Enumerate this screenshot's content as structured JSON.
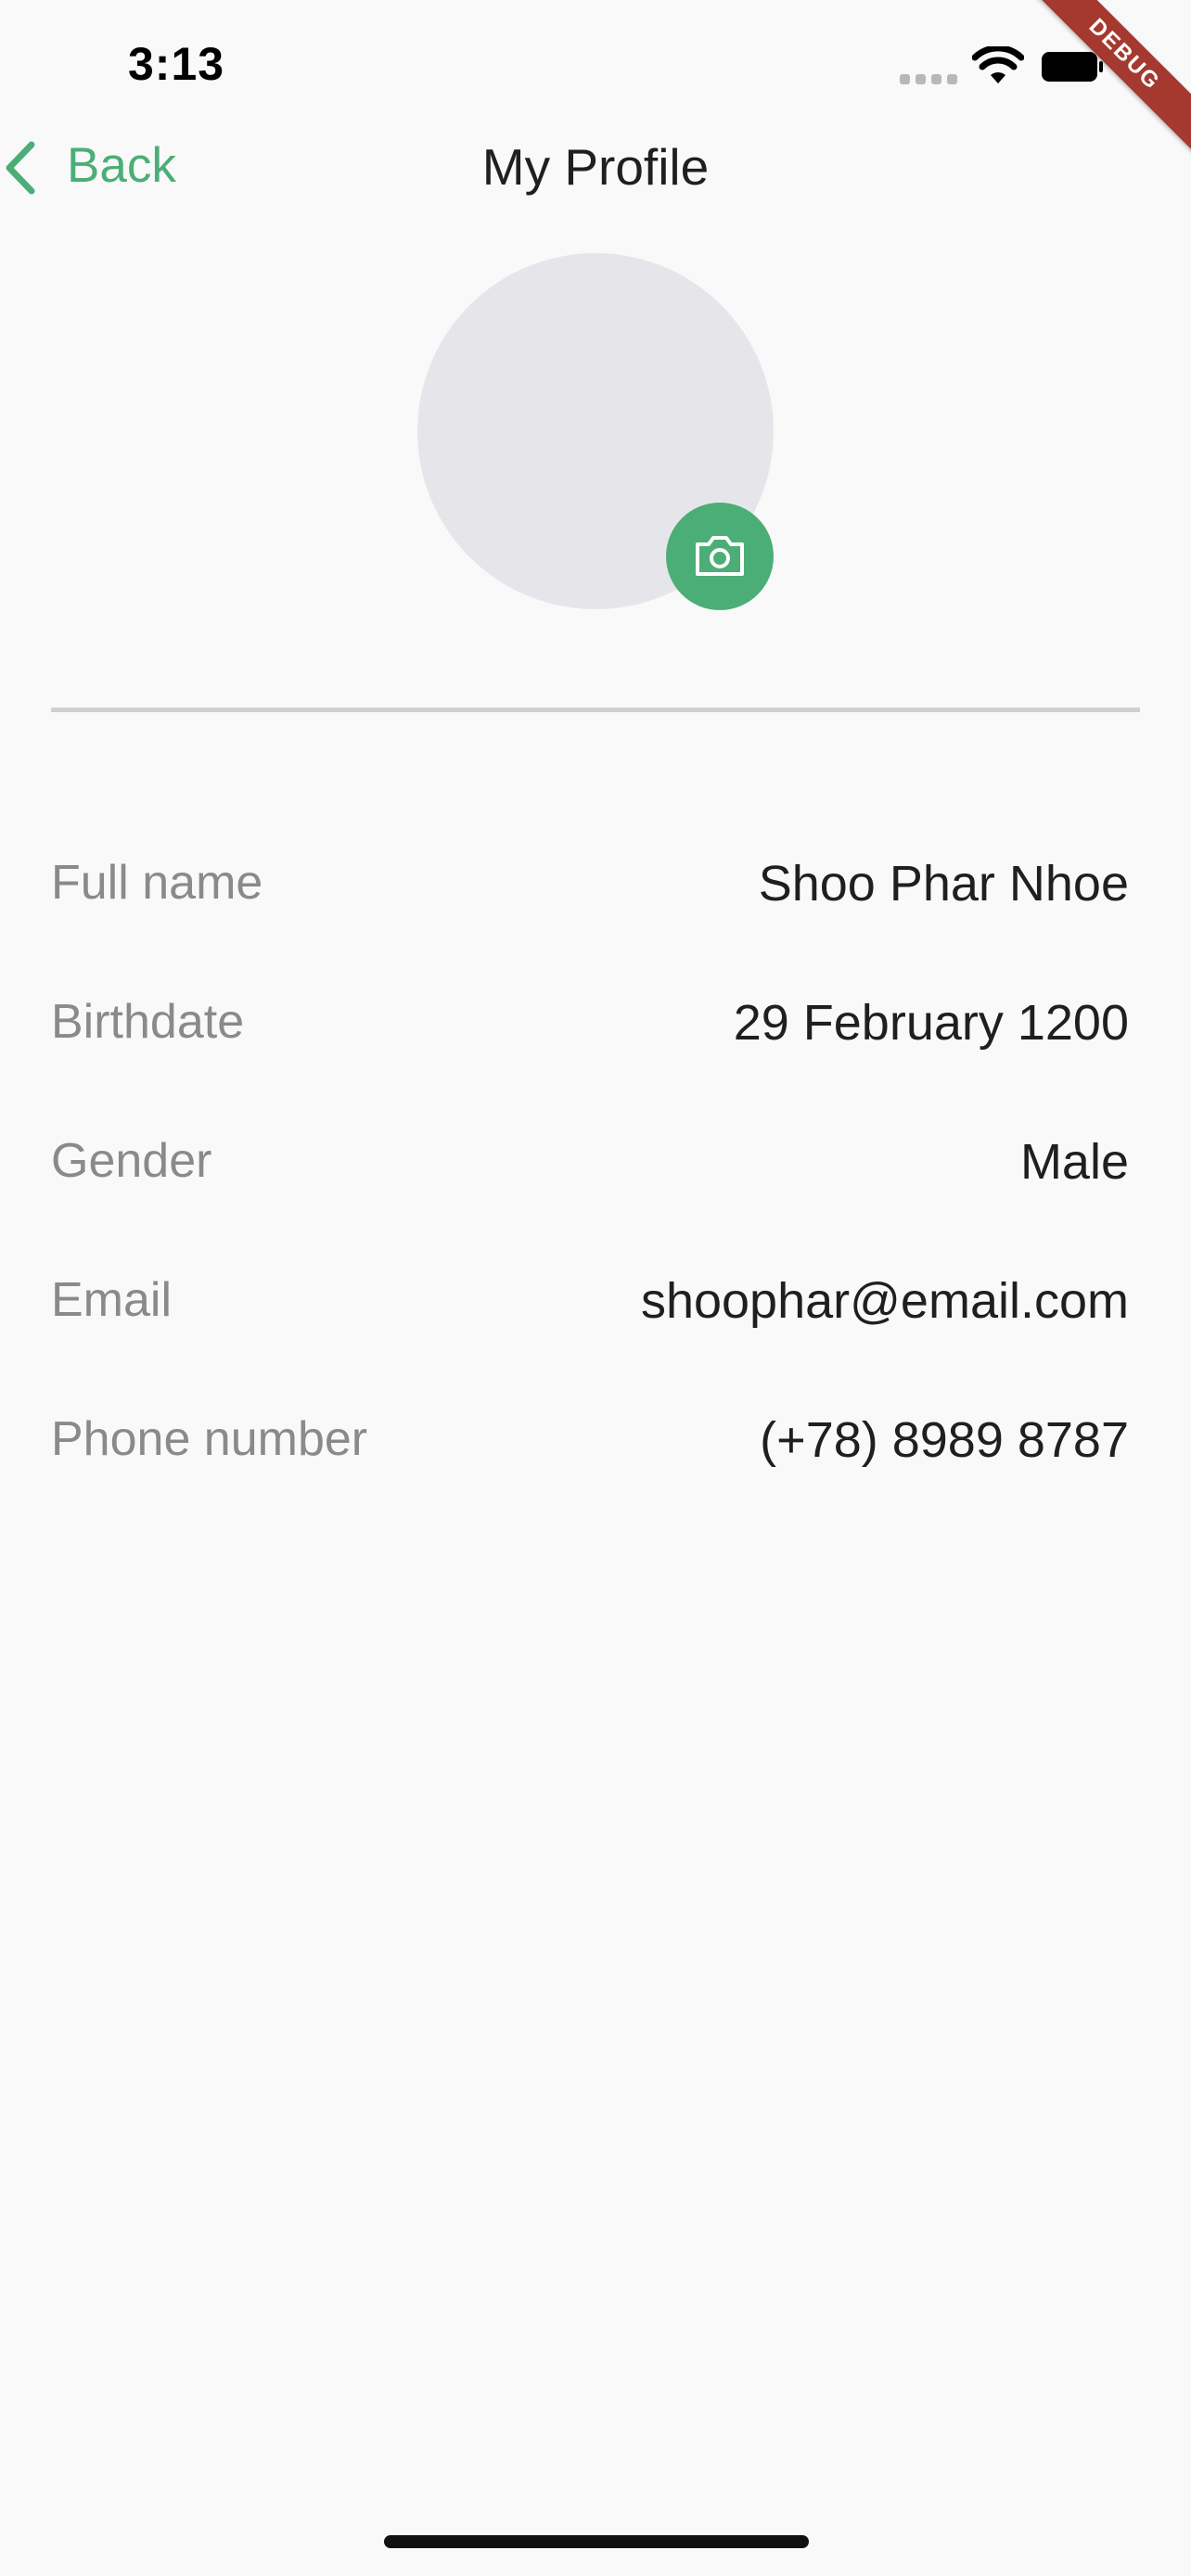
{
  "status_bar": {
    "time": "3:13"
  },
  "debug_banner": "DEBUG",
  "nav": {
    "back_label": "Back",
    "title": "My Profile"
  },
  "profile": {
    "fields": [
      {
        "label": "Full name",
        "value": "Shoo Phar Nhoe"
      },
      {
        "label": "Birthdate",
        "value": "29 February 1200"
      },
      {
        "label": "Gender",
        "value": "Male"
      },
      {
        "label": "Email",
        "value": "shoophar@email.com"
      },
      {
        "label": "Phone number",
        "value": "(+78) 8989 8787"
      }
    ]
  },
  "icons": {
    "back": "chevron-left-icon",
    "camera": "camera-icon",
    "wifi": "wifi-icon",
    "battery": "battery-icon",
    "signal": "cellular-signal-icon"
  },
  "colors": {
    "accent": "#4cae77",
    "background": "#f9f9f9",
    "avatar_placeholder": "#e6e6ea",
    "label_text": "#8a8a8a",
    "value_text": "#1f1f1f",
    "debug_ribbon": "#a6392f"
  }
}
